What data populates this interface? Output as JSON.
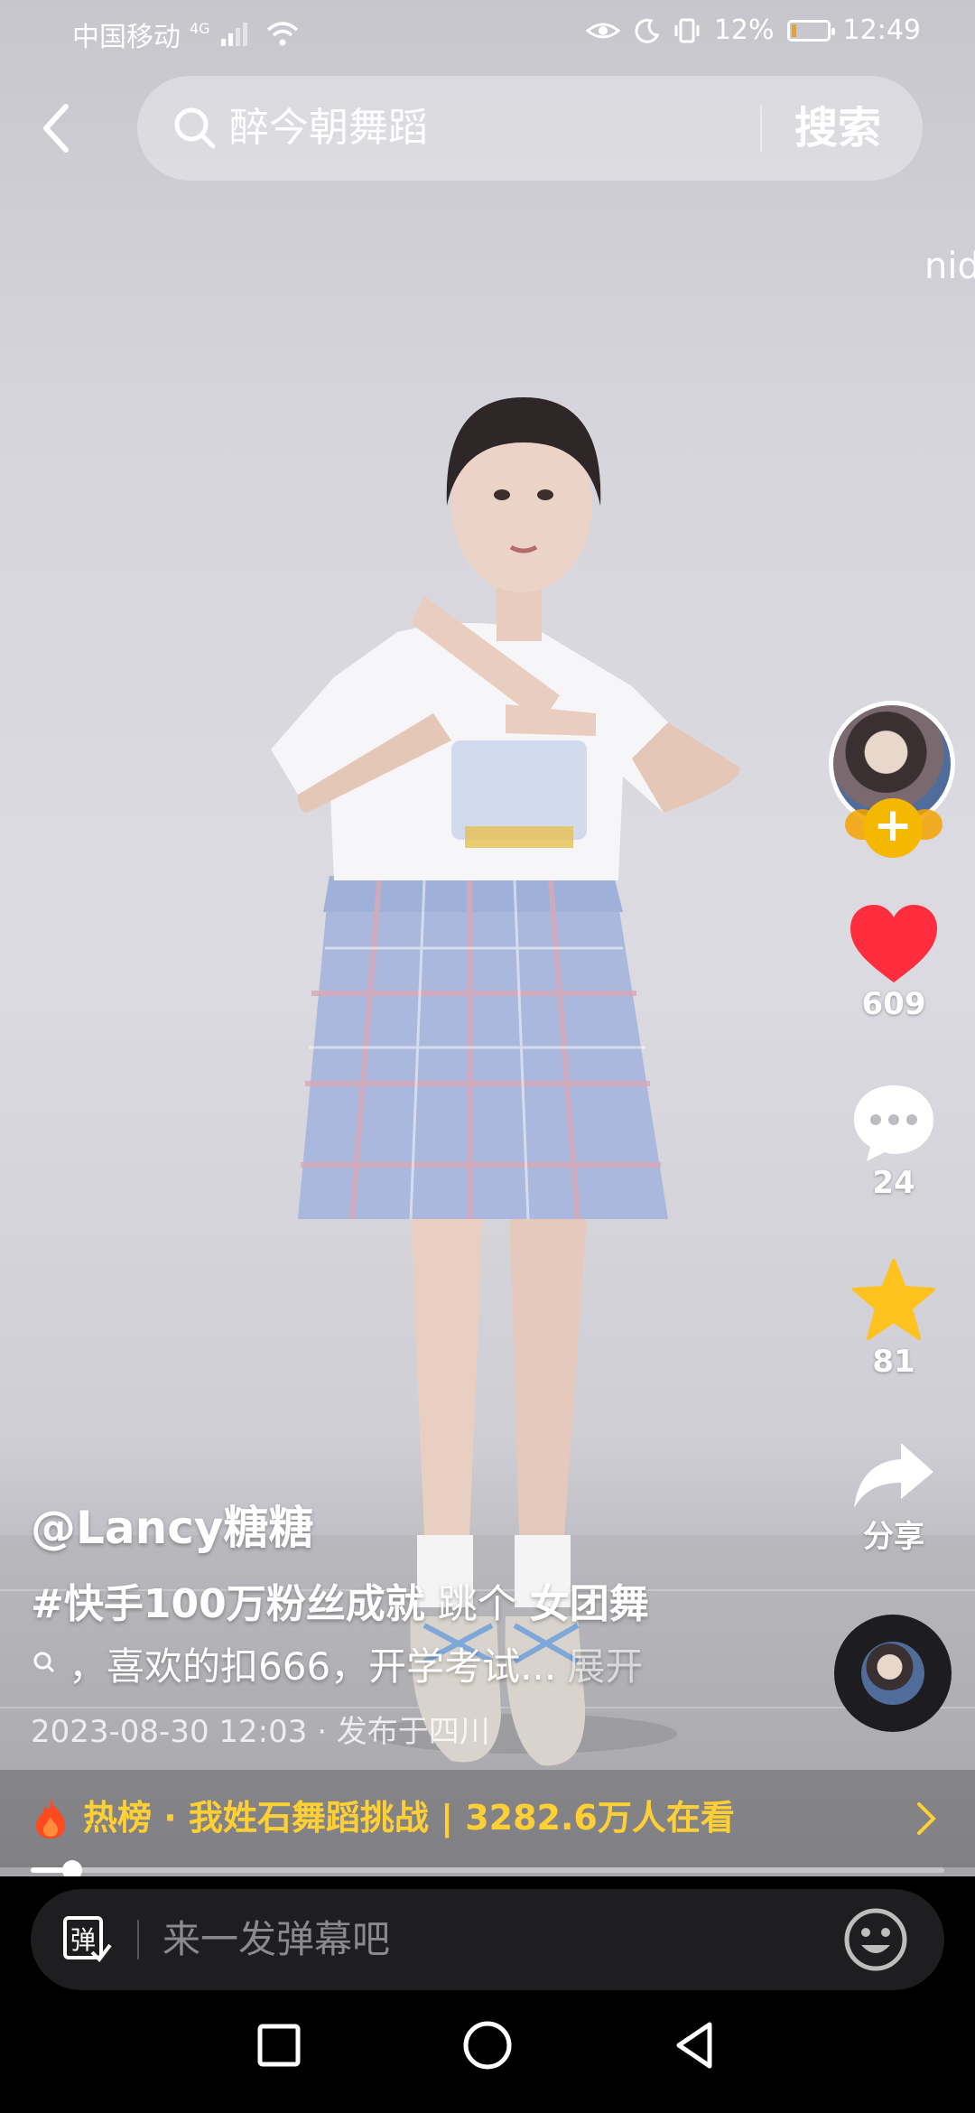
{
  "status_bar": {
    "carrier": "中国移动",
    "network": "4G",
    "battery": "12%",
    "time": "12:49",
    "battery_level": 0.12
  },
  "search": {
    "query": "醉今朝舞蹈",
    "button": "搜索"
  },
  "side_text": "nid",
  "rail": {
    "follow_symbol": "+",
    "likes": "609",
    "comments": "24",
    "favorites": "81",
    "share": "分享"
  },
  "post": {
    "author": "@Lancy糖糖",
    "hashtag": "#快手100万粉丝成就",
    "tag_middle": "跳个",
    "tag_bold": "女团舞",
    "description": "，喜欢的扣666，开学考试...",
    "expand": "展开",
    "meta": "2023-08-30 12:03 · 发布于四川"
  },
  "hot": {
    "label": "热榜 · 我姓石舞蹈挑战 | 3282.6万人在看"
  },
  "playback": {
    "progress_fraction": 0.045
  },
  "comment_bar": {
    "danmaku_glyph": "弹",
    "placeholder": "来一发弹幕吧"
  },
  "colors": {
    "like_red": "#ff2d3d",
    "star_yellow": "#ffc21f",
    "hot_yellow": "#ffd033",
    "follow_yellow": "#f5b800"
  }
}
